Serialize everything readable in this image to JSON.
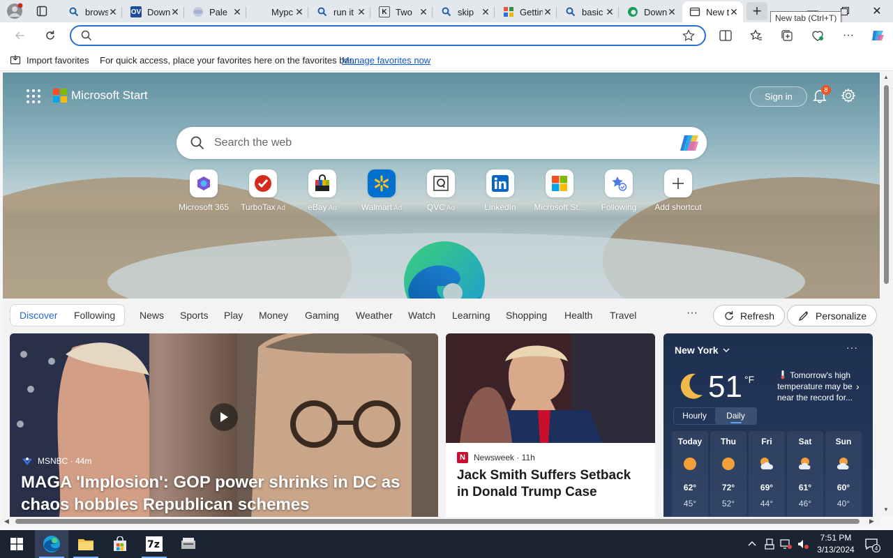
{
  "tabs": [
    {
      "title": "browser",
      "favicon": "search-icon"
    },
    {
      "title": "Download",
      "favicon": "ov-logo-icon"
    },
    {
      "title": "Pale",
      "favicon": "globe-icon"
    },
    {
      "title": "Mypc",
      "favicon": "blank-icon"
    },
    {
      "title": "run it",
      "favicon": "search-icon"
    },
    {
      "title": "Two",
      "favicon": "k-logo-icon"
    },
    {
      "title": "skip",
      "favicon": "search-icon"
    },
    {
      "title": "Getting",
      "favicon": "puzzle-icon"
    },
    {
      "title": "basic",
      "favicon": "search-icon"
    },
    {
      "title": "Download",
      "favicon": "edge-icon"
    },
    {
      "title": "New tab",
      "favicon": "newtab-icon"
    }
  ],
  "tooltip": "New tab (Ctrl+T)",
  "address": {
    "value": "",
    "placeholder": ""
  },
  "favorites_bar": {
    "import_label": "Import favorites",
    "hint": "For quick access, place your favorites here on the favorites bar.",
    "manage_link": "Manage favorites now"
  },
  "header": {
    "brand": "Microsoft Start",
    "sign_in": "Sign in",
    "notification_count": "8"
  },
  "web_search": {
    "placeholder": "Search the web"
  },
  "shortcuts": [
    {
      "label": "Microsoft 365",
      "ad": ""
    },
    {
      "label": "TurboTax",
      "ad": "Ad"
    },
    {
      "label": "eBay",
      "ad": "Ad"
    },
    {
      "label": "Walmart",
      "ad": "Ad"
    },
    {
      "label": "QVC",
      "ad": "Ad"
    },
    {
      "label": "LinkedIn",
      "ad": ""
    },
    {
      "label": "Microsoft St...",
      "ad": ""
    },
    {
      "label": "Following",
      "ad": ""
    },
    {
      "label": "Add shortcut",
      "ad": ""
    }
  ],
  "feed_tabs": {
    "discover": "Discover",
    "following": "Following"
  },
  "categories": [
    "News",
    "Sports",
    "Play",
    "Money",
    "Gaming",
    "Weather",
    "Watch",
    "Learning",
    "Shopping",
    "Health",
    "Travel"
  ],
  "more": "···",
  "refresh": "Refresh",
  "personalize": "Personalize",
  "cards": [
    {
      "source": "MSNBC · 44m",
      "headline": "MAGA 'Implosion': GOP power shrinks in DC as chaos hobbles Republican schemes"
    },
    {
      "source": "Newsweek · 11h",
      "headline": "Jack Smith Suffers Setback in Donald Trump Case"
    }
  ],
  "weather": {
    "city": "New York",
    "temp": "51",
    "unit": "°F",
    "tip": "Tomorrow's high temperature may be near the record for...",
    "modes": [
      "Hourly",
      "Daily"
    ],
    "days": [
      {
        "name": "Today",
        "hi": "62°",
        "lo": "45°",
        "icon": "sunny-icon"
      },
      {
        "name": "Thu",
        "hi": "72°",
        "lo": "52°",
        "icon": "sunny-icon"
      },
      {
        "name": "Fri",
        "hi": "69°",
        "lo": "44°",
        "icon": "partly-cloudy-icon"
      },
      {
        "name": "Sat",
        "hi": "61°",
        "lo": "46°",
        "icon": "partly-cloudy-icon"
      },
      {
        "name": "Sun",
        "hi": "60°",
        "lo": "40°",
        "icon": "partly-cloudy-icon"
      }
    ]
  },
  "taskbar": {
    "time": "7:51 PM",
    "date": "3/13/2024",
    "notification_count": "4"
  }
}
